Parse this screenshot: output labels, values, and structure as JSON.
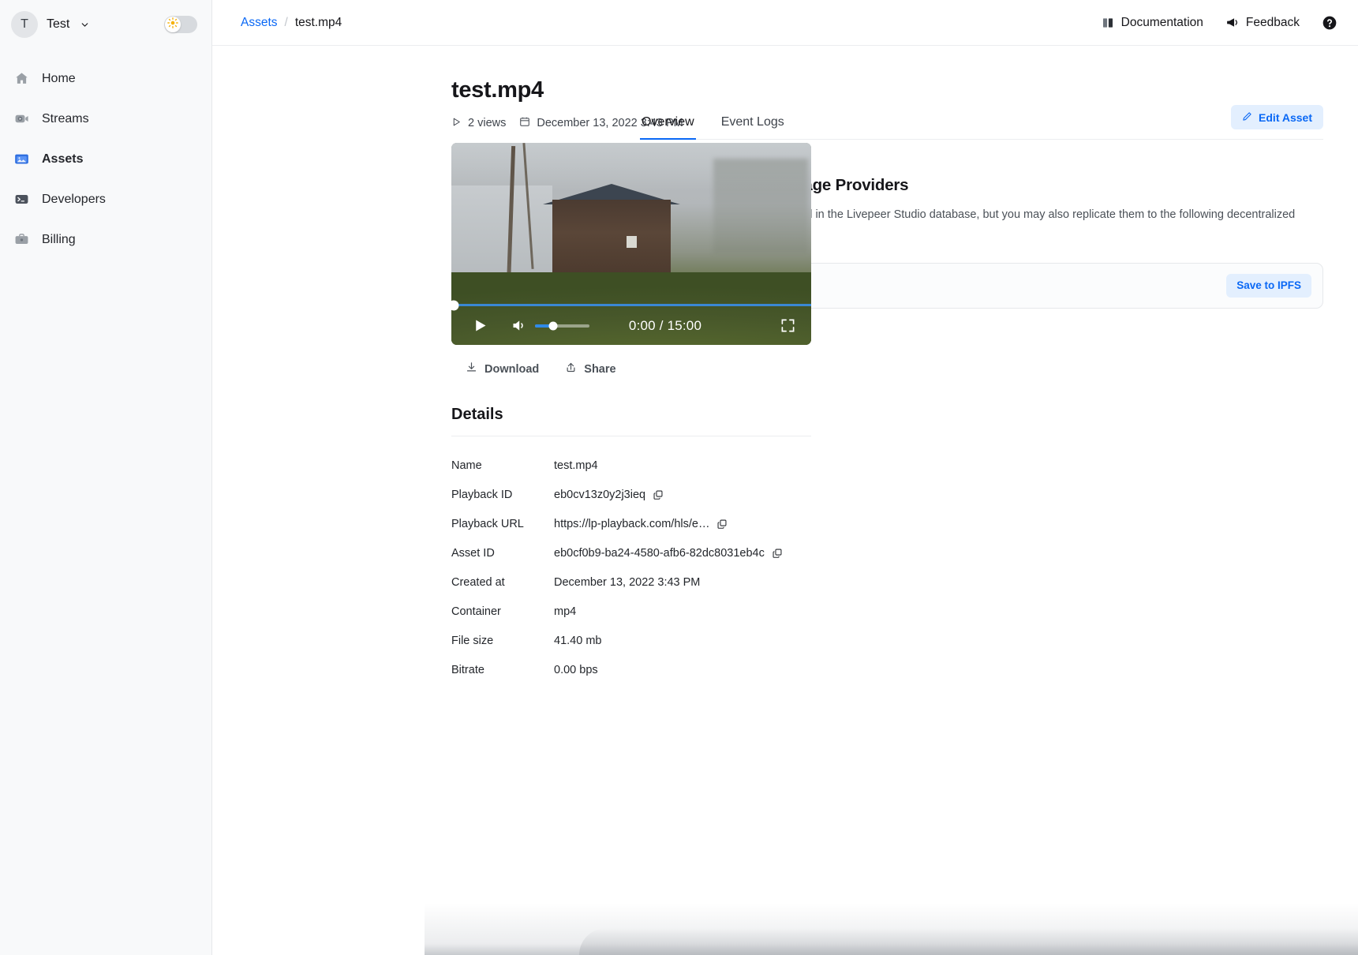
{
  "sidebar": {
    "org": {
      "avatar_initial": "T",
      "name": "Test",
      "chevron_icon": "chevron-down-icon"
    },
    "theme_toggle": {
      "icon": "sun-icon",
      "state": "light"
    },
    "items": [
      {
        "label": "Home",
        "icon": "home-icon",
        "active": false
      },
      {
        "label": "Streams",
        "icon": "streams-icon",
        "active": false
      },
      {
        "label": "Assets",
        "icon": "assets-icon",
        "active": true
      },
      {
        "label": "Developers",
        "icon": "terminal-icon",
        "active": false
      },
      {
        "label": "Billing",
        "icon": "billing-icon",
        "active": false
      }
    ]
  },
  "topbar": {
    "breadcrumb": {
      "parent": "Assets",
      "separator": "/",
      "current": "test.mp4"
    },
    "documentation_label": "Documentation",
    "feedback_label": "Feedback",
    "help_icon": "help-circle-icon"
  },
  "asset": {
    "title": "test.mp4",
    "views": "2 views",
    "created_display": "December 13, 2022 3:43 PM",
    "player": {
      "current_time": "0:00",
      "duration": "15:00",
      "time_display": "0:00 / 15:00",
      "progress_percent": 0,
      "volume_percent": 33,
      "play_icon": "play-icon",
      "volume_icon": "volume-icon",
      "fullscreen_icon": "fullscreen-icon"
    },
    "actions": [
      {
        "label": "Download",
        "icon": "download-icon"
      },
      {
        "label": "Share",
        "icon": "share-icon"
      }
    ]
  },
  "details": {
    "heading": "Details",
    "rows": [
      {
        "label": "Name",
        "value": "test.mp4",
        "copyable": false
      },
      {
        "label": "Playback ID",
        "value": "eb0cv13z0y2j3ieq",
        "copyable": true
      },
      {
        "label": "Playback URL",
        "value": "https://lp-playback.com/hls/e…",
        "copyable": true
      },
      {
        "label": "Asset ID",
        "value": "eb0cf0b9-ba24-4580-afb6-82dc8031eb4c",
        "copyable": true
      },
      {
        "label": "Created at",
        "value": "December 13, 2022 3:43 PM",
        "copyable": false
      },
      {
        "label": "Container",
        "value": "mp4",
        "copyable": false
      },
      {
        "label": "File size",
        "value": "41.40 mb",
        "copyable": false
      },
      {
        "label": "Bitrate",
        "value": "0.00 bps",
        "copyable": false
      }
    ]
  },
  "panel": {
    "tabs": [
      {
        "label": "Overview",
        "active": true
      },
      {
        "label": "Event Logs",
        "active": false
      }
    ],
    "edit_button": {
      "label": "Edit Asset",
      "icon": "pencil-icon"
    },
    "storage": {
      "icon": "database-icon",
      "title": "Decentralized Storage Providers",
      "description": "By default video assets are stored in the Livepeer Studio database, but you may also replicate them to the following decentralized storage providers.",
      "providers": [
        {
          "name": "IPFS",
          "icon": "cube-icon",
          "action_label": "Save to IPFS"
        }
      ]
    }
  },
  "colors": {
    "accent_blue": "#0a68f5",
    "accent_blue_soft": "#e3effe",
    "sidebar_bg": "#f8f9fa",
    "border": "#e6e8eb",
    "text": "#16161a",
    "muted_text": "#4b5158",
    "toggle_sun": "#f5b312"
  }
}
